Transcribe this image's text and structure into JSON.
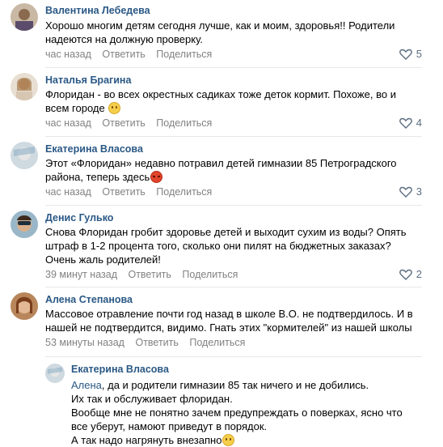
{
  "comments": [
    {
      "author": "Валентина Лебедева",
      "lines": [
        "Хорошо многим детям сегодня лучше, как и моим, здоровья!! Родители",
        "надеются на должную проверку."
      ],
      "time": "час назад",
      "reply": "Ответить",
      "share": "Поделиться",
      "likes": "5"
    },
    {
      "author": "Наталья Брагина",
      "lines": [
        "Флоридан - во всех окрестных садиках тоже деток кормит. Похоже, во и",
        "всем городе"
      ],
      "time": "час назад",
      "reply": "Ответить",
      "share": "Поделиться",
      "likes": "4"
    },
    {
      "author": "Екатерина Власова",
      "lines": [
        "Этот «Флоридан» недавно потравил детей гимназии 85 Петроградского",
        "района, теперь здесь"
      ],
      "time": "час назад",
      "reply": "Ответить",
      "share": "Поделиться",
      "likes": "3"
    },
    {
      "author": "Денис Гулько",
      "lines": [
        "Снова Флоридан гробит здоровье детей и выходит сухим из воды? Опять",
        "штраф в 1-2 процента того, сколько они пилят на бюджетных заказах?",
        "Очень жаль родителей!"
      ],
      "time": "39 минут назад",
      "reply": "Ответить",
      "share": "Поделиться",
      "likes": "2"
    },
    {
      "author": "Алена Степанова",
      "lines": [
        "Массовое отравление почти год назад в школе В.О. не подтвердилось. И в",
        "нашей не подтвердится, видимо. Гнать этих \"кормителей\" из нашей школы"
      ],
      "time": "53 минуты назад",
      "reply": "Ответить",
      "share": "Поделиться",
      "likes": ""
    }
  ],
  "reply_comment": {
    "author": "Екатерина Власова",
    "addressee": "Алена",
    "lines": [
      ", да и родители гимназии 85 так ничего и не добились.",
      "Их так и обслуживает флоридан.",
      "Вообще мне не понятно зачем предупреждать о поверках, ясно что",
      "все уберут, намоют приведут в порядок.",
      "А так надо нагрянуть внезапно"
    ]
  },
  "icons": {
    "like": "heart-outline-icon",
    "smile": "smile-emoji-icon",
    "angry": "angry-emoji-icon"
  },
  "colors": {
    "author": "#2a5885",
    "meta": "#828282",
    "divider": "#e7e8ec"
  }
}
